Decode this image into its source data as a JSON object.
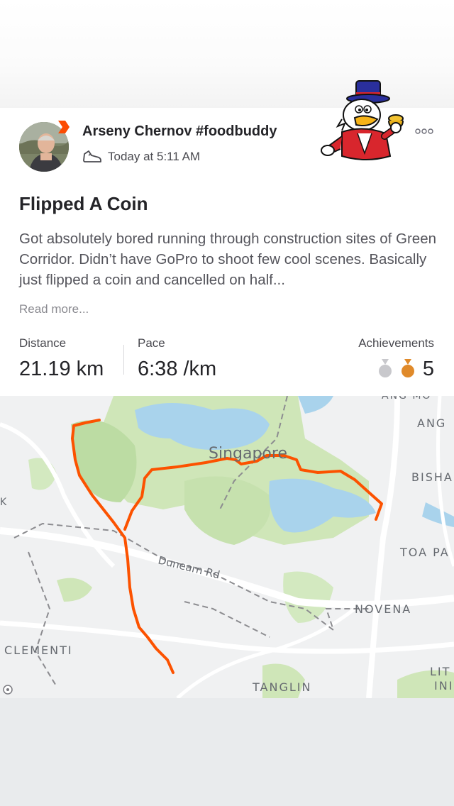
{
  "post": {
    "author": "Arseny Chernov #foodbuddy",
    "timestamp": "Today at 5:11 AM",
    "title": "Flipped A Coin",
    "description": "Got absolutely bored running through construction sites of Green Corridor. Didn’t have GoPro to shoot few cool scenes. Basically just flipped a coin and cancelled on half...",
    "read_more": "Read more..."
  },
  "stats": {
    "distance_label": "Distance",
    "distance_value": "21.19 km",
    "pace_label": "Pace",
    "pace_value": "6:38 /km",
    "achievements_label": "Achievements",
    "achievements_count": "5"
  },
  "map": {
    "labels": {
      "singapore": "Singapore",
      "dunearn": "Dunearn Rd",
      "clementi": "CLEMENTI",
      "tanglin": "TANGLIN",
      "novena": "NOVENA",
      "toa_payoh": "TOA PA",
      "bishan": "BISHA",
      "ang": "ANG",
      "ang_mo_kio": "ANG MO",
      "lit": "LIT",
      "ini": "INI",
      "k": "K"
    }
  },
  "colors": {
    "route": "#fc5200",
    "brand": "#fc4c02",
    "bronze_medal": "#e08a2a",
    "silver_medal": "#c8c8cc"
  },
  "icons": {
    "activity": "shoe-icon",
    "more": "more-dots-icon",
    "map_attribution": "mapbox-logo-icon"
  }
}
